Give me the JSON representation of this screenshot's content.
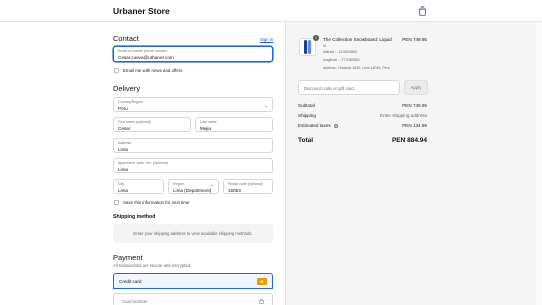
{
  "header": {
    "brand": "Urbaner Store",
    "cart_icon": "shopping-bag-icon"
  },
  "contact": {
    "title": "Contact",
    "signin_label": "Sign in",
    "email": {
      "label": "Email or mobile phone number",
      "value": "Cesar.cueva@urbaner.com"
    },
    "news_label": "Email me with news and offers"
  },
  "delivery": {
    "title": "Delivery",
    "country": {
      "label": "Country/Region",
      "value": "Peru"
    },
    "first_name": {
      "label": "First name (optional)",
      "value": "Cesar"
    },
    "last_name": {
      "label": "Last name",
      "value": "Mejia"
    },
    "address": {
      "label": "Address",
      "value": "Lima"
    },
    "apartment": {
      "label": "Apartment, suite, etc. (optional)",
      "value": "Lima"
    },
    "city": {
      "label": "City",
      "value": "Lima"
    },
    "region": {
      "label": "Region",
      "value": "Lima (Department)"
    },
    "postal": {
      "label": "Postal code (optional)",
      "value": "15063"
    },
    "save_label": "Save this information for next time"
  },
  "shipping": {
    "title": "Shipping method",
    "placeholder": "Enter your shipping address to view available shipping methods."
  },
  "payment": {
    "title": "Payment",
    "subtitle": "All transactions are secure and encrypted.",
    "credit_card_label": "Credit card",
    "card_badge": "B",
    "card_number_placeholder": "Card number"
  },
  "summary": {
    "product": {
      "name": "The Collection Snowboard: Liquid",
      "quantity": "1",
      "variant_1": "M",
      "variant_2": "latitude : -12.0604563",
      "variant_3": "longitude : -77.0489552",
      "variant_4": "address : Huascar 4630, Lima 15046, Peru",
      "price": "PEN 749.95"
    },
    "discount_placeholder": "Discount code or gift card",
    "apply_label": "Apply",
    "subtotal_label": "Subtotal",
    "subtotal_value": "PEN 749.95",
    "shipping_label": "Shipping",
    "shipping_value": "Enter shipping address",
    "taxes_label": "Estimated taxes",
    "taxes_value": "PEN 134.99",
    "total_label": "Total",
    "total_value": "PEN 884.94"
  }
}
